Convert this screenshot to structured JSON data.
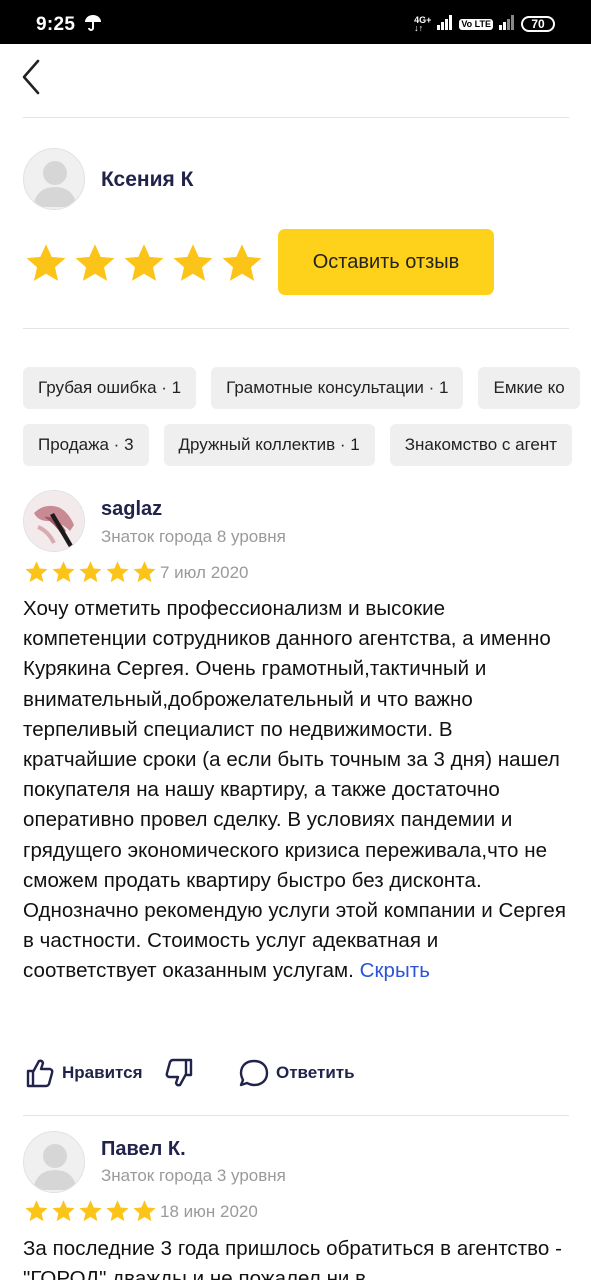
{
  "status_bar": {
    "time": "9:25",
    "network_top": "4G+",
    "network_bottom": "↓↑",
    "volte": "Vo LTE",
    "battery": "70"
  },
  "profile": {
    "name": "Ксения К",
    "rating_stars": 5,
    "leave_review_label": "Оставить отзыв"
  },
  "tags_row1": [
    "Грубая ошибка · 1",
    "Грамотные консультации · 1",
    "Емкие ко"
  ],
  "tags_row2": [
    "Продажа · 3",
    "Дружный коллектив · 1",
    "Знакомство с агент"
  ],
  "reviews": [
    {
      "author": "saglaz",
      "level": "Знаток города 8 уровня",
      "stars": 5,
      "date": "7 июл 2020",
      "text": "Хочу отметить профессионализм и высокие компетенции сотрудников данного агентства, а именно Курякина Сергея. Очень грамотный,тактичный и внимательный,доброжелательный и что важно терпеливый специалист по недвижимости. В кратчайшие сроки (а если быть точным за 3 дня) нашел покупателя на нашу квартиру, а также достаточно оперативно провел сделку. В условиях пандемии и грядущего экономического кризиса переживала,что не сможем продать квартиру быстро без дисконта. Однозначно рекомендую услуги этой компании и Сергея в частности. Стоимость услуг адекватная и соответствует оказанным услугам.",
      "collapse_label": "Скрыть",
      "like_label": "Нравится",
      "reply_label": "Ответить"
    },
    {
      "author": "Павел К.",
      "level": "Знаток города 3 уровня",
      "stars": 5,
      "date": "18 июн 2020",
      "text": "За последние 3 года пришлось обратиться в агентство - \"ГОРОД\" дважды и не пожалел ни в"
    }
  ],
  "colors": {
    "star": "#fcc419",
    "accent_button": "#fed11a",
    "name_text": "#21234a",
    "link": "#2c54d6"
  }
}
